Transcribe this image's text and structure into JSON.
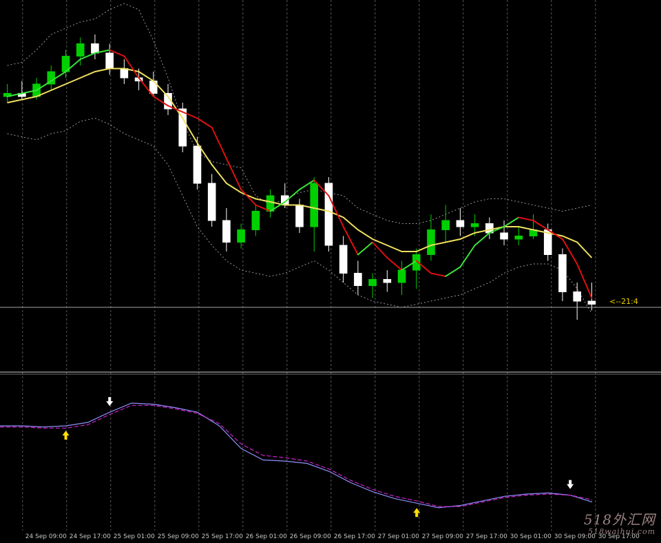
{
  "chart_data": [
    {
      "type": "candlestick",
      "grid": true,
      "background": "#000000",
      "colors": {
        "bull": "#00d000",
        "bear": "#ffffff",
        "ma_fast_up": "#39e339",
        "ma_fast_down": "#e01010",
        "ma_slow": "#f0e060",
        "bands": "#9a9a9a",
        "hline": "#a8a8a8"
      },
      "y_domain": [
        0,
        100
      ],
      "price_tag": "<--21:4",
      "price_line_level": 12,
      "x_tick_labels": [
        "24 Sep 09:00",
        "24 Sep 17:00",
        "25 Sep 01:00",
        "25 Sep 09:00",
        "25 Sep 17:00",
        "26 Sep 01:00",
        "26 Sep 09:00",
        "26 Sep 17:00",
        "27 Sep 01:00",
        "27 Sep 09:00",
        "27 Sep 17:00",
        "30 Sep 01:00",
        "30 Sep 09:00",
        "30 Sep 17:00"
      ],
      "moving_average_fast": [
        80,
        81,
        82,
        85,
        88,
        92,
        94,
        95,
        93,
        86,
        80,
        77,
        75,
        73,
        70,
        60,
        50,
        45,
        43,
        46,
        50,
        53,
        48,
        38,
        29,
        33,
        28,
        24,
        27,
        23,
        22,
        25,
        32,
        36,
        38,
        41,
        40,
        37,
        34,
        26,
        15
      ],
      "moving_average_slow": [
        78,
        79,
        80,
        82,
        84,
        86,
        88,
        89,
        89,
        88,
        85,
        80,
        73,
        65,
        58,
        52,
        49,
        47,
        46,
        45,
        45,
        44,
        43,
        41,
        37,
        34,
        32,
        30,
        30,
        32,
        33,
        34,
        36,
        37,
        38,
        38,
        37,
        36,
        35,
        33,
        28
      ],
      "upper_band": [
        90,
        91,
        95,
        100,
        102,
        104,
        105,
        108,
        110,
        108,
        98,
        86,
        72,
        62,
        59,
        58,
        57,
        48,
        45,
        47,
        49,
        50,
        49,
        48,
        44,
        42,
        40,
        39,
        39,
        40,
        42,
        44,
        46,
        47,
        47,
        46,
        45,
        44,
        43,
        44,
        45
      ],
      "lower_band": [
        68,
        67,
        66,
        68,
        69,
        72,
        73,
        71,
        68,
        66,
        64,
        58,
        48,
        38,
        32,
        27,
        24,
        23,
        22,
        23,
        25,
        27,
        24,
        20,
        16,
        14,
        13,
        12,
        13,
        14,
        15,
        16,
        18,
        20,
        23,
        25,
        26,
        26,
        24,
        18,
        10
      ],
      "candles": [
        {
          "o": 80,
          "h": 84,
          "l": 78,
          "c": 81
        },
        {
          "o": 81,
          "h": 85,
          "l": 79,
          "c": 80
        },
        {
          "o": 80,
          "h": 86,
          "l": 79,
          "c": 84
        },
        {
          "o": 84,
          "h": 90,
          "l": 82,
          "c": 88
        },
        {
          "o": 88,
          "h": 95,
          "l": 86,
          "c": 93
        },
        {
          "o": 93,
          "h": 99,
          "l": 90,
          "c": 97
        },
        {
          "o": 97,
          "h": 100,
          "l": 92,
          "c": 94
        },
        {
          "o": 94,
          "h": 97,
          "l": 87,
          "c": 89
        },
        {
          "o": 89,
          "h": 92,
          "l": 84,
          "c": 86
        },
        {
          "o": 86,
          "h": 89,
          "l": 82,
          "c": 85
        },
        {
          "o": 85,
          "h": 88,
          "l": 80,
          "c": 81
        },
        {
          "o": 81,
          "h": 84,
          "l": 74,
          "c": 76
        },
        {
          "o": 76,
          "h": 78,
          "l": 62,
          "c": 64
        },
        {
          "o": 64,
          "h": 67,
          "l": 50,
          "c": 52
        },
        {
          "o": 52,
          "h": 55,
          "l": 38,
          "c": 40
        },
        {
          "o": 40,
          "h": 44,
          "l": 30,
          "c": 33
        },
        {
          "o": 33,
          "h": 39,
          "l": 31,
          "c": 37
        },
        {
          "o": 37,
          "h": 45,
          "l": 35,
          "c": 43
        },
        {
          "o": 43,
          "h": 50,
          "l": 41,
          "c": 48
        },
        {
          "o": 48,
          "h": 52,
          "l": 44,
          "c": 45
        },
        {
          "o": 45,
          "h": 47,
          "l": 36,
          "c": 38
        },
        {
          "o": 38,
          "h": 54,
          "l": 30,
          "c": 52
        },
        {
          "o": 52,
          "h": 54,
          "l": 30,
          "c": 32
        },
        {
          "o": 32,
          "h": 35,
          "l": 20,
          "c": 23
        },
        {
          "o": 23,
          "h": 27,
          "l": 16,
          "c": 19
        },
        {
          "o": 19,
          "h": 23,
          "l": 15,
          "c": 21
        },
        {
          "o": 21,
          "h": 24,
          "l": 17,
          "c": 20
        },
        {
          "o": 20,
          "h": 27,
          "l": 16,
          "c": 24
        },
        {
          "o": 24,
          "h": 31,
          "l": 18,
          "c": 29
        },
        {
          "o": 29,
          "h": 42,
          "l": 27,
          "c": 37
        },
        {
          "o": 37,
          "h": 45,
          "l": 33,
          "c": 40
        },
        {
          "o": 40,
          "h": 44,
          "l": 35,
          "c": 38
        },
        {
          "o": 38,
          "h": 42,
          "l": 35,
          "c": 39
        },
        {
          "o": 39,
          "h": 41,
          "l": 34,
          "c": 36
        },
        {
          "o": 36,
          "h": 40,
          "l": 32,
          "c": 34
        },
        {
          "o": 34,
          "h": 38,
          "l": 32,
          "c": 35
        },
        {
          "o": 35,
          "h": 42,
          "l": 34,
          "c": 37
        },
        {
          "o": 37,
          "h": 39,
          "l": 27,
          "c": 29
        },
        {
          "o": 29,
          "h": 31,
          "l": 14,
          "c": 17
        },
        {
          "o": 17,
          "h": 20,
          "l": 8,
          "c": 14
        },
        {
          "o": 14,
          "h": 20,
          "l": 11,
          "c": 13
        }
      ]
    },
    {
      "type": "line",
      "grid": true,
      "y_domain": [
        0,
        100
      ],
      "series": [
        {
          "color": "#9090ff",
          "values": [
            80,
            80,
            79,
            80,
            83,
            92,
            100,
            99,
            96,
            92,
            80,
            60,
            50,
            49,
            47,
            40,
            30,
            22,
            16,
            12,
            8,
            10,
            14,
            18,
            20,
            21,
            19,
            13
          ]
        },
        {
          "color": "#d020d0",
          "dashed": true,
          "values": [
            79,
            79,
            78,
            78,
            81,
            90,
            98,
            98,
            95,
            91,
            82,
            64,
            54,
            52,
            49,
            42,
            32,
            24,
            18,
            14,
            9,
            9,
            13,
            17,
            19,
            20,
            19,
            15
          ]
        }
      ],
      "signals_up": [
        3,
        19
      ],
      "signals_down": [
        5,
        26
      ]
    }
  ],
  "watermark": {
    "line1": "518外汇网",
    "line2": "518waihui.com"
  }
}
